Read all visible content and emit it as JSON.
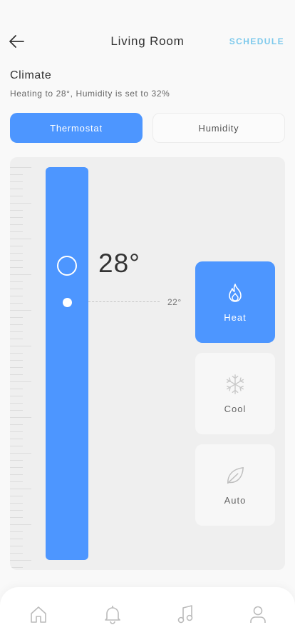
{
  "header": {
    "back_icon": "arrow-left-icon",
    "title": "Living Room",
    "schedule_label": "SCHEDULE"
  },
  "climate": {
    "title": "Climate",
    "subtitle": "Heating to 28°, Humidity is set to 32%"
  },
  "tabs": [
    {
      "label": "Thermostat",
      "active": true
    },
    {
      "label": "Humidity",
      "active": false
    }
  ],
  "thermostat": {
    "target_temp": "28°",
    "current_temp": "22°"
  },
  "modes": [
    {
      "label": "Heat",
      "icon": "flame-icon",
      "active": true
    },
    {
      "label": "Cool",
      "icon": "snowflake-icon",
      "active": false
    },
    {
      "label": "Auto",
      "icon": "leaf-icon",
      "active": false
    }
  ],
  "nav": [
    {
      "icon": "home-icon"
    },
    {
      "icon": "bell-icon"
    },
    {
      "icon": "music-icon"
    },
    {
      "icon": "user-icon"
    }
  ],
  "colors": {
    "accent": "#4d96ff",
    "schedule": "#7cc9ec",
    "background": "#f9f9f9",
    "panel": "#efefef"
  }
}
